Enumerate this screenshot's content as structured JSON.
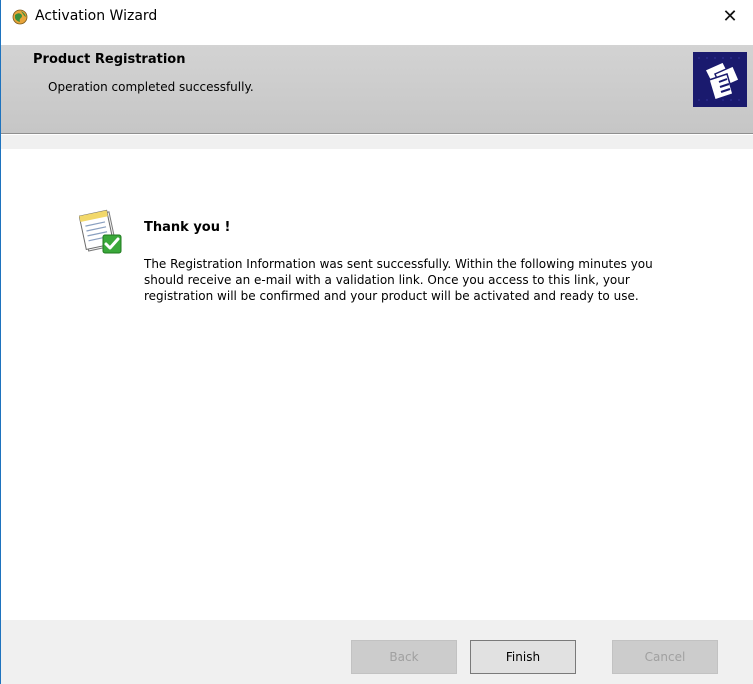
{
  "window": {
    "title": "Activation Wizard",
    "close_glyph": "✕"
  },
  "header": {
    "title": "Product Registration",
    "subtitle": "Operation completed successfully."
  },
  "content": {
    "heading": "Thank you !",
    "message": "The Registration Information was sent successfully. Within the following minutes you should receive an e-mail with a validation link. Once you access to this link, your registration will be confirmed and your product will be activated and ready to use."
  },
  "buttons": {
    "back": "Back",
    "finish": "Finish",
    "cancel": "Cancel"
  },
  "icons": {
    "app": "activation-globe-icon",
    "header_logo": "registration-cards-icon",
    "content": "document-checkmark-icon"
  },
  "colors": {
    "header_bg": "#cfcfcf",
    "logo_bg": "#1a1a6e",
    "check_green": "#3aa83a",
    "window_border": "#1e73be"
  }
}
